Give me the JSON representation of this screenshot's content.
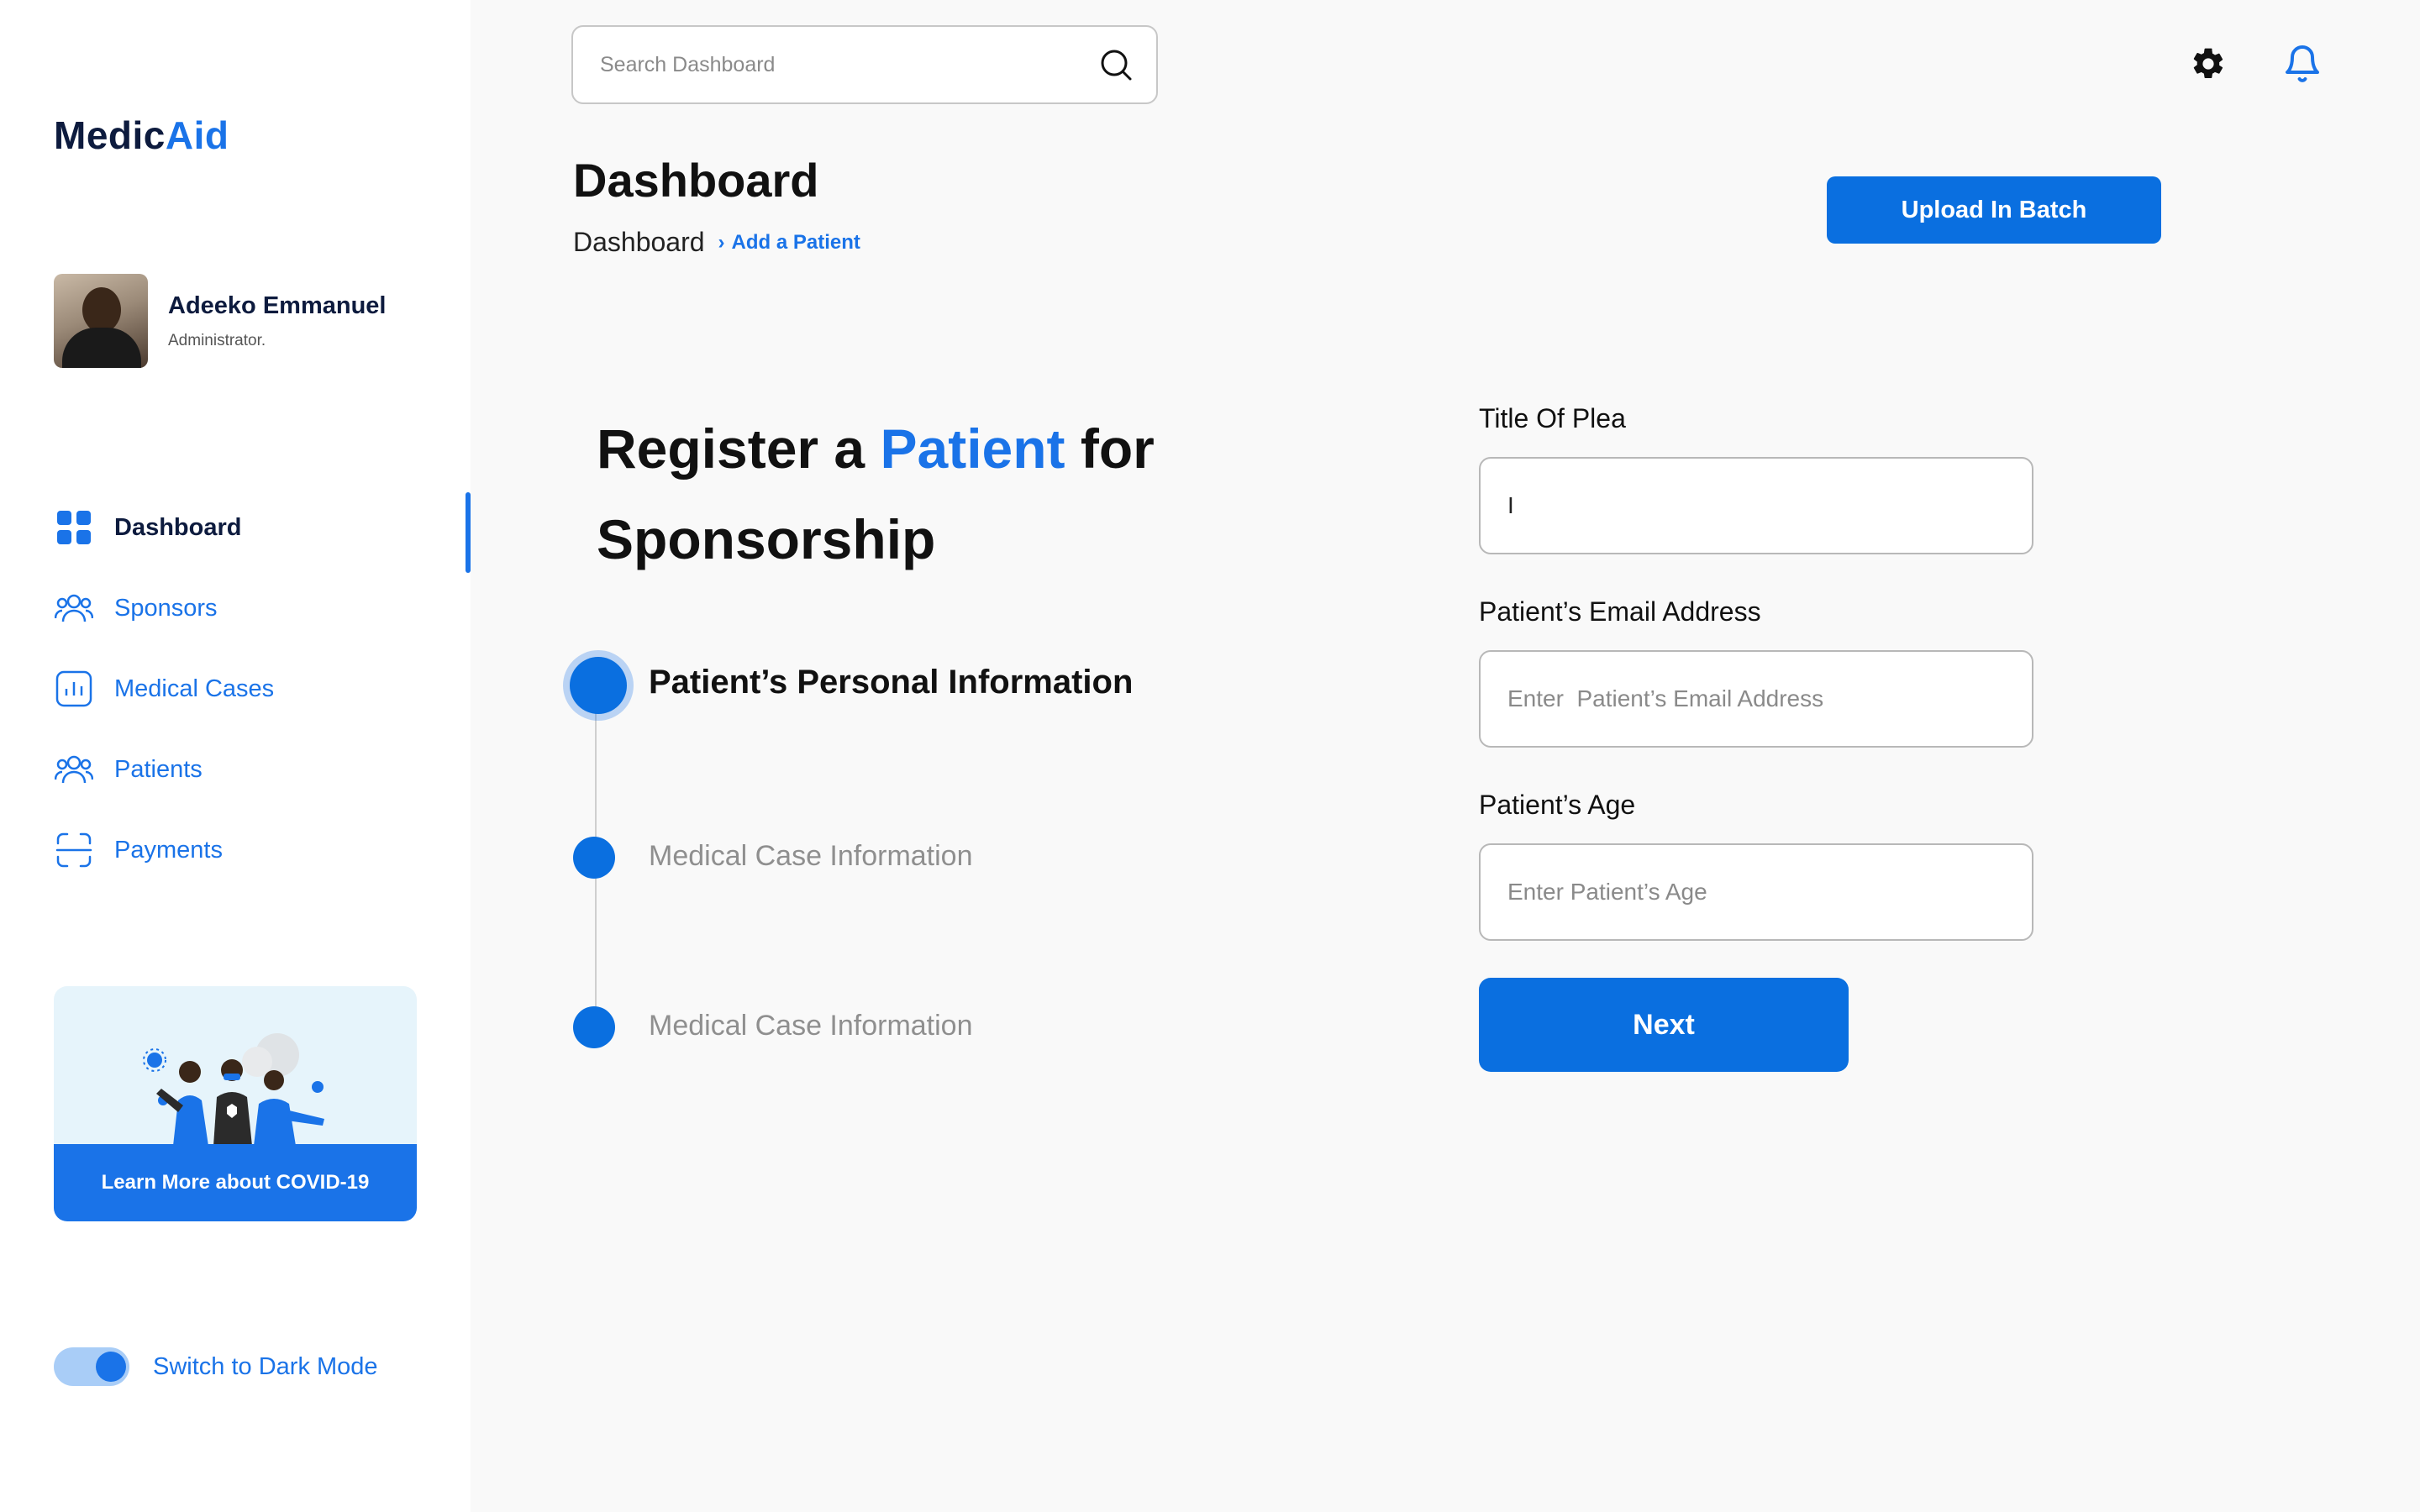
{
  "brand": {
    "name_part1": "Medic",
    "name_part2": "Aid"
  },
  "user": {
    "name": "Adeeko Emmanuel",
    "role": "Administrator."
  },
  "sidebar": {
    "items": [
      {
        "label": "Dashboard",
        "icon": "grid-icon",
        "active": true
      },
      {
        "label": "Sponsors",
        "icon": "users-icon"
      },
      {
        "label": "Medical Cases",
        "icon": "chart-icon"
      },
      {
        "label": "Patients",
        "icon": "users-icon"
      },
      {
        "label": "Payments",
        "icon": "scan-icon"
      }
    ],
    "covid_button": "Learn More about COVID-19",
    "dark_mode_label": "Switch to Dark Mode"
  },
  "search": {
    "placeholder": "Search Dashboard"
  },
  "header": {
    "title": "Dashboard",
    "breadcrumb_root": "Dashboard",
    "breadcrumb_current": "Add a Patient",
    "upload_button": "Upload In Batch"
  },
  "heading": {
    "part1": "Register a ",
    "accent": "Patient",
    "part2": " for",
    "line2": "Sponsorship"
  },
  "steps": [
    {
      "label": "Patient’s Personal Information",
      "active": true
    },
    {
      "label": "Medical Case Information",
      "active": false
    },
    {
      "label": "Medical Case Information",
      "active": false
    }
  ],
  "form": {
    "title_label": "Title Of Plea",
    "title_value": "I",
    "email_label": "Patient’s Email Address",
    "email_placeholder": "Enter  Patient’s Email Address",
    "age_label": "Patient’s Age",
    "age_placeholder": "Enter Patient’s Age",
    "next_button": "Next"
  },
  "colors": {
    "accent": "#1a73e8",
    "navy": "#0d1b3e"
  }
}
